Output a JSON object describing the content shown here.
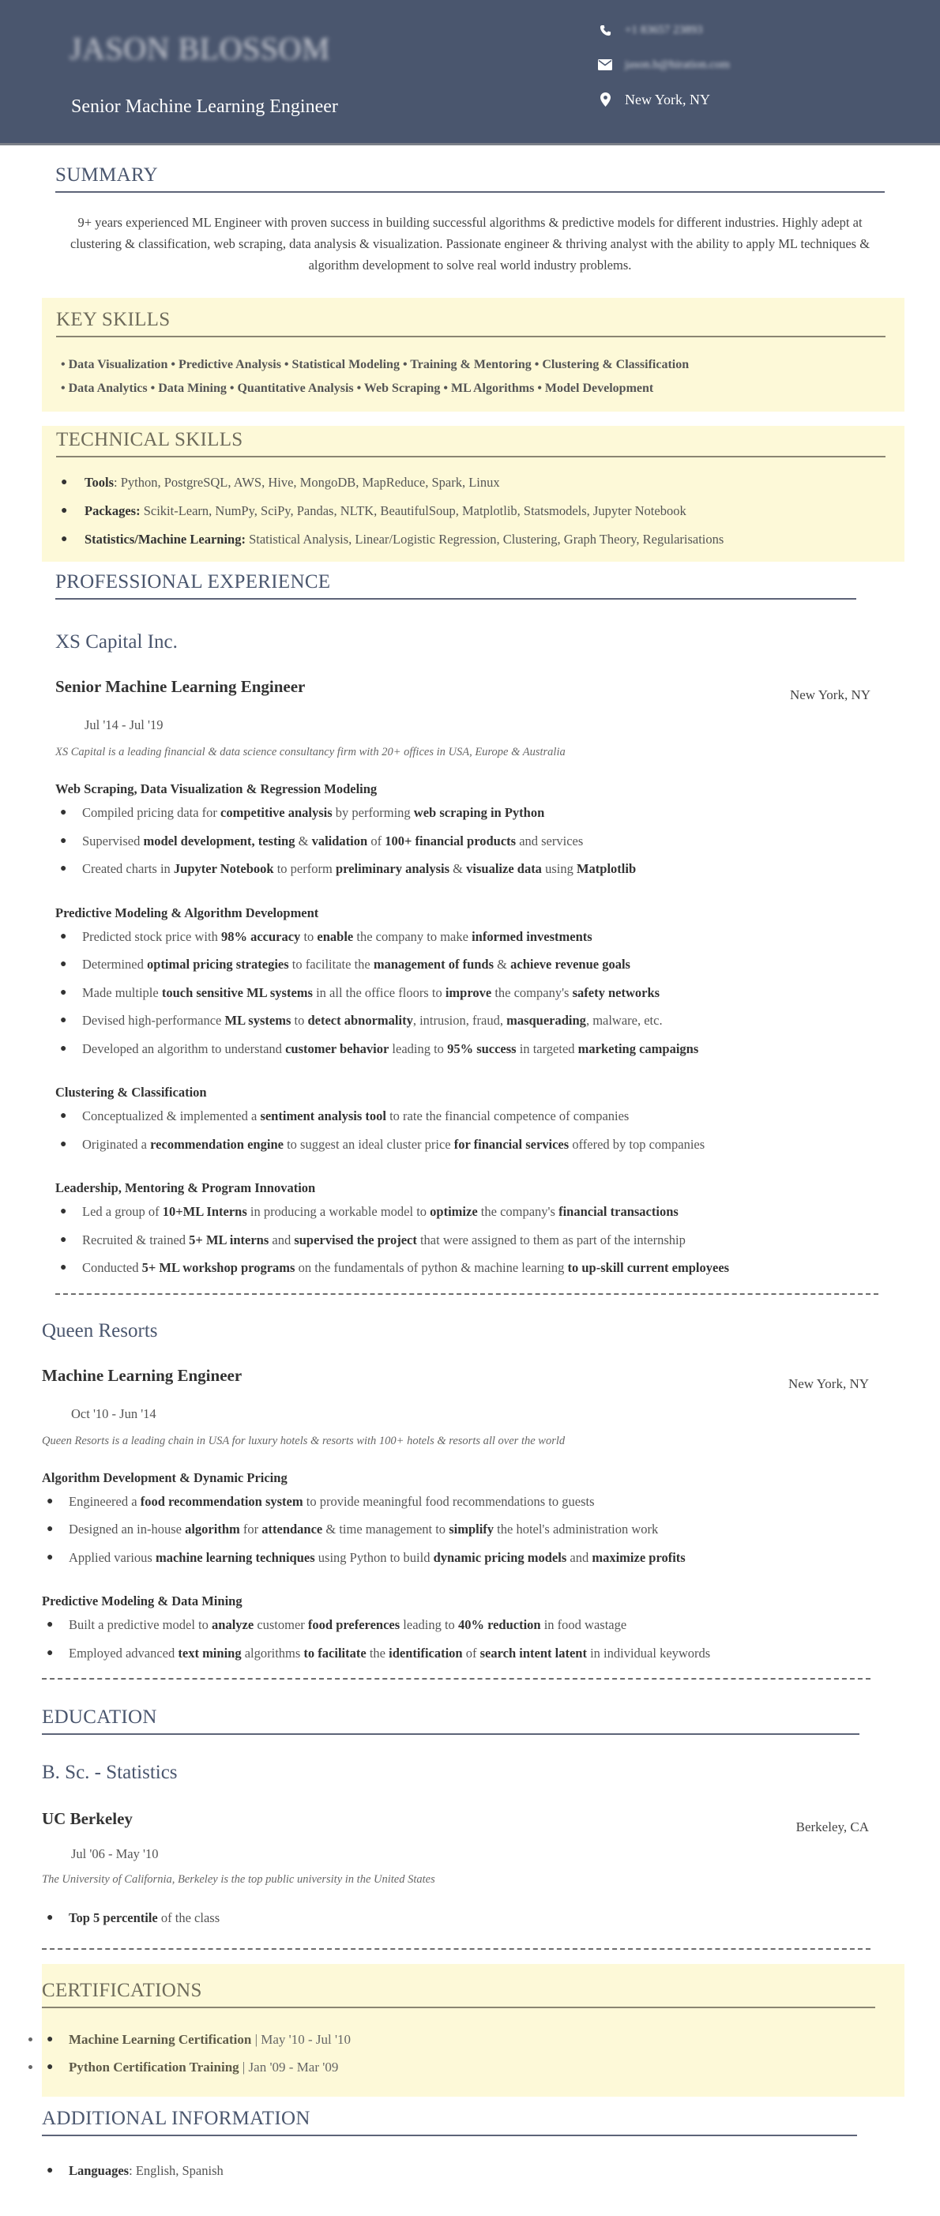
{
  "header": {
    "name": "JASON BLOSSOM",
    "role": "Senior Machine Learning Engineer",
    "phone": "+1 83657 23893",
    "email": "jason.b@hiration.com",
    "location": "New York, NY",
    "bg_color": "#4a566e"
  },
  "summary": {
    "title": "SUMMARY",
    "text": "9+ years experienced ML Engineer with proven success in building successful algorithms & predictive models for different industries. Highly adept at clustering & classification, web scraping, data analysis & visualization. Passionate engineer & thriving analyst with the ability to apply ML techniques & algorithm development to solve real world industry problems."
  },
  "key_skills": {
    "title": "KEY SKILLS",
    "lines": [
      "• Data Visualization • Predictive Analysis • Statistical Modeling • Training & Mentoring • Clustering & Classification",
      "• Data Analytics • Data Mining • Quantitative Analysis • Web Scraping • ML Algorithms • Model Development"
    ]
  },
  "technical_skills": {
    "title": "TECHNICAL SKILLS",
    "items": [
      {
        "label": "Tools",
        "sep": ": ",
        "value": "Python, PostgreSQL, AWS, Hive, MongoDB, MapReduce, Spark, Linux"
      },
      {
        "label": "Packages:",
        "sep": " ",
        "value": "Scikit-Learn, NumPy, SciPy, Pandas, NLTK, BeautifulSoup, Matplotlib, Statsmodels, Jupyter Notebook"
      },
      {
        "label": "Statistics/Machine Learning:",
        "sep": " ",
        "value": "Statistical Analysis, Linear/Logistic Regression, Clustering, Graph Theory, Regularisations"
      }
    ]
  },
  "experience": {
    "title": "PROFESSIONAL EXPERIENCE",
    "jobs": [
      {
        "company": "XS Capital Inc.",
        "title": "Senior Machine Learning Engineer",
        "location": "New York, NY",
        "dates": "Jul '14 - Jul '19",
        "description": "XS Capital is a leading financial & data science consultancy firm with 20+ offices in USA, Europe & Australia",
        "groups": [
          {
            "heading": "Web Scraping, Data Visualization & Regression Modeling",
            "bullets": [
              [
                [
                  "Compiled pricing data for ",
                  false
                ],
                [
                  "competitive analysis",
                  true
                ],
                [
                  " by performing ",
                  false
                ],
                [
                  "web scraping in Python",
                  true
                ]
              ],
              [
                [
                  "Supervised ",
                  false
                ],
                [
                  "model development, testing",
                  true
                ],
                [
                  " & ",
                  false
                ],
                [
                  "validation",
                  true
                ],
                [
                  " of ",
                  false
                ],
                [
                  "100+ financial products",
                  true
                ],
                [
                  " and services",
                  false
                ]
              ],
              [
                [
                  "Created charts in ",
                  false
                ],
                [
                  "Jupyter Notebook",
                  true
                ],
                [
                  " to perform ",
                  false
                ],
                [
                  "preliminary analysis",
                  true
                ],
                [
                  " & ",
                  false
                ],
                [
                  "visualize data",
                  true
                ],
                [
                  " using ",
                  false
                ],
                [
                  "Matplotlib",
                  true
                ]
              ]
            ]
          },
          {
            "heading": "Predictive Modeling & Algorithm Development",
            "bullets": [
              [
                [
                  "Predicted stock price with ",
                  false
                ],
                [
                  "98% accuracy",
                  true
                ],
                [
                  " to ",
                  false
                ],
                [
                  "enable",
                  true
                ],
                [
                  " the company to make ",
                  false
                ],
                [
                  "informed investments",
                  true
                ]
              ],
              [
                [
                  "Determined ",
                  false
                ],
                [
                  "optimal pricing strategies",
                  true
                ],
                [
                  " to facilitate the ",
                  false
                ],
                [
                  "management of funds",
                  true
                ],
                [
                  " & ",
                  false
                ],
                [
                  "achieve revenue goals",
                  true
                ]
              ],
              [
                [
                  "Made multiple ",
                  false
                ],
                [
                  "touch sensitive ML systems",
                  true
                ],
                [
                  " in all the office floors to ",
                  false
                ],
                [
                  "improve",
                  true
                ],
                [
                  " the company's ",
                  false
                ],
                [
                  "safety networks",
                  true
                ]
              ],
              [
                [
                  "Devised high-performance ",
                  false
                ],
                [
                  "ML systems",
                  true
                ],
                [
                  " to ",
                  false
                ],
                [
                  "detect abnormality",
                  true
                ],
                [
                  ", intrusion, fraud, ",
                  false
                ],
                [
                  "masquerading",
                  true
                ],
                [
                  ", malware, etc.",
                  false
                ]
              ],
              [
                [
                  "Developed an algorithm to understand ",
                  false
                ],
                [
                  "customer behavior",
                  true
                ],
                [
                  " leading to ",
                  false
                ],
                [
                  "95% success",
                  true
                ],
                [
                  " in targeted ",
                  false
                ],
                [
                  "marketing campaigns",
                  true
                ]
              ]
            ]
          },
          {
            "heading": "Clustering & Classification",
            "bullets": [
              [
                [
                  "Conceptualized & implemented a ",
                  false
                ],
                [
                  "sentiment analysis tool",
                  true
                ],
                [
                  " to rate the financial competence of companies",
                  false
                ]
              ],
              [
                [
                  "Originated a ",
                  false
                ],
                [
                  "recommendation engine",
                  true
                ],
                [
                  " to suggest an ideal cluster price ",
                  false
                ],
                [
                  "for financial services",
                  true
                ],
                [
                  " offered by top companies",
                  false
                ]
              ]
            ]
          },
          {
            "heading": "Leadership, Mentoring & Program Innovation",
            "bullets": [
              [
                [
                  "Led a group of ",
                  false
                ],
                [
                  "10+ML Interns",
                  true
                ],
                [
                  " in producing a workable model to ",
                  false
                ],
                [
                  "optimize",
                  true
                ],
                [
                  " the company's ",
                  false
                ],
                [
                  "financial transactions",
                  true
                ]
              ],
              [
                [
                  "Recruited & trained ",
                  false
                ],
                [
                  "5+ ML interns",
                  true
                ],
                [
                  " and ",
                  false
                ],
                [
                  "supervised the project",
                  true
                ],
                [
                  " that were assigned to them as part of the internship",
                  false
                ]
              ],
              [
                [
                  "Conducted ",
                  false
                ],
                [
                  "5+ ML workshop programs",
                  true
                ],
                [
                  " on the fundamentals of python & machine learning ",
                  false
                ],
                [
                  "to up-skill current employees",
                  true
                ]
              ]
            ]
          }
        ]
      },
      {
        "company": "Queen Resorts",
        "title": "Machine Learning Engineer",
        "location": "New York, NY",
        "dates": "Oct '10 - Jun '14",
        "description": "Queen Resorts is a leading chain in USA for luxury hotels & resorts with 100+ hotels & resorts all over the world",
        "groups": [
          {
            "heading": "Algorithm Development & Dynamic Pricing",
            "bullets": [
              [
                [
                  "Engineered a ",
                  false
                ],
                [
                  "food recommendation system",
                  true
                ],
                [
                  " to provide meaningful food recommendations to guests",
                  false
                ]
              ],
              [
                [
                  "Designed an in-house ",
                  false
                ],
                [
                  "algorithm",
                  true
                ],
                [
                  " for ",
                  false
                ],
                [
                  "attendance",
                  true
                ],
                [
                  " & time management to ",
                  false
                ],
                [
                  "simplify",
                  true
                ],
                [
                  " the hotel's administration work",
                  false
                ]
              ],
              [
                [
                  "Applied various ",
                  false
                ],
                [
                  "machine learning techniques",
                  true
                ],
                [
                  " using Python to build ",
                  false
                ],
                [
                  "dynamic pricing models",
                  true
                ],
                [
                  " and ",
                  false
                ],
                [
                  "maximize profits",
                  true
                ]
              ]
            ]
          },
          {
            "heading": "Predictive Modeling & Data Mining",
            "bullets": [
              [
                [
                  "Built a predictive model to ",
                  false
                ],
                [
                  "analyze",
                  true
                ],
                [
                  " customer ",
                  false
                ],
                [
                  "food preferences",
                  true
                ],
                [
                  " leading to ",
                  false
                ],
                [
                  "40% reduction",
                  true
                ],
                [
                  " in food wastage",
                  false
                ]
              ],
              [
                [
                  "Employed advanced ",
                  false
                ],
                [
                  "text mining",
                  true
                ],
                [
                  " algorithms ",
                  false
                ],
                [
                  "to facilitate",
                  true
                ],
                [
                  " the ",
                  false
                ],
                [
                  "identification",
                  true
                ],
                [
                  " of ",
                  false
                ],
                [
                  "search intent latent",
                  true
                ],
                [
                  " in individual keywords",
                  false
                ]
              ]
            ]
          }
        ]
      }
    ]
  },
  "education": {
    "title": "EDUCATION",
    "degree": "B. Sc. - Statistics",
    "school": "UC Berkeley",
    "location": "Berkeley, CA",
    "dates": "Jul '06 - May '10",
    "description": "The University of California, Berkeley is the top public university in the United States",
    "bullets": [
      [
        [
          "Top 5 percentile",
          true
        ],
        [
          " of the class",
          false
        ]
      ]
    ]
  },
  "certifications": {
    "title": "CERTIFICATIONS",
    "items": [
      {
        "name": "Machine Learning Certification",
        "dates": " | May '10 - Jul '10"
      },
      {
        "name": "Python Certification Training",
        "dates": " | Jan '09 - Mar '09"
      }
    ]
  },
  "additional": {
    "title": "ADDITIONAL INFORMATION",
    "items": [
      {
        "label": "Languages",
        "value": ": English, Spanish"
      }
    ]
  }
}
